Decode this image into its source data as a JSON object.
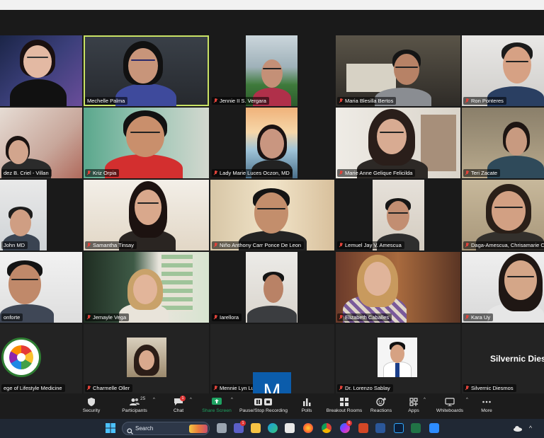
{
  "participants": [
    {
      "name": ""
    },
    {
      "name": "Mechelle Palma"
    },
    {
      "name": "Jennie II S. Vergara"
    },
    {
      "name": "Maria Blesilla Bertos"
    },
    {
      "name": "Ron Ponteres"
    },
    {
      "name": "dez B. Criel - Villan"
    },
    {
      "name": "Kriz Orpia"
    },
    {
      "name": "Lady Marie Luces Oczon, MD"
    },
    {
      "name": "Marie Anne Gelique Felicilda"
    },
    {
      "name": "Teri Zacate"
    },
    {
      "name": "John MD"
    },
    {
      "name": "Samantha Tinsay"
    },
    {
      "name": "Niño Anthony Carr Ponce De Leon"
    },
    {
      "name": "Lemuel Jay V. Amescua"
    },
    {
      "name": "Daga-Amescua, Chrisamarie Ch"
    },
    {
      "name": "onforte"
    },
    {
      "name": "Jemayle Vega"
    },
    {
      "name": "Iarellora"
    },
    {
      "name": "Elizabeth Caballes"
    },
    {
      "name": "Kara Uy"
    },
    {
      "name": "ege of Lifestyle Medicine"
    },
    {
      "name": "Charmelle Oller"
    },
    {
      "name": "Mennie Lyn Luceña"
    },
    {
      "name": "Dr. Lorenzo Sablay"
    },
    {
      "name": "Silvernic Diesmos"
    }
  ],
  "avatar_letter": "M",
  "silvernic_display": "Silvernic Diesr",
  "toolbar": {
    "security": "Security",
    "participants": "Participants",
    "participants_count": "25",
    "chat": "Chat",
    "chat_badge": "1",
    "share_screen": "Share Screen",
    "record": "Pause/Stop Recording",
    "polls": "Polls",
    "breakout": "Breakout Rooms",
    "reactions": "Reactions",
    "apps": "Apps",
    "whiteboards": "Whiteboards",
    "more": "More"
  },
  "taskbar": {
    "search": "Search",
    "teams_badge": "1",
    "messenger_badge": "6"
  },
  "colors": {
    "active_speaker_border": "#c9e265",
    "share_green": "#1ea362",
    "mic_muted_red": "#e0433a"
  }
}
